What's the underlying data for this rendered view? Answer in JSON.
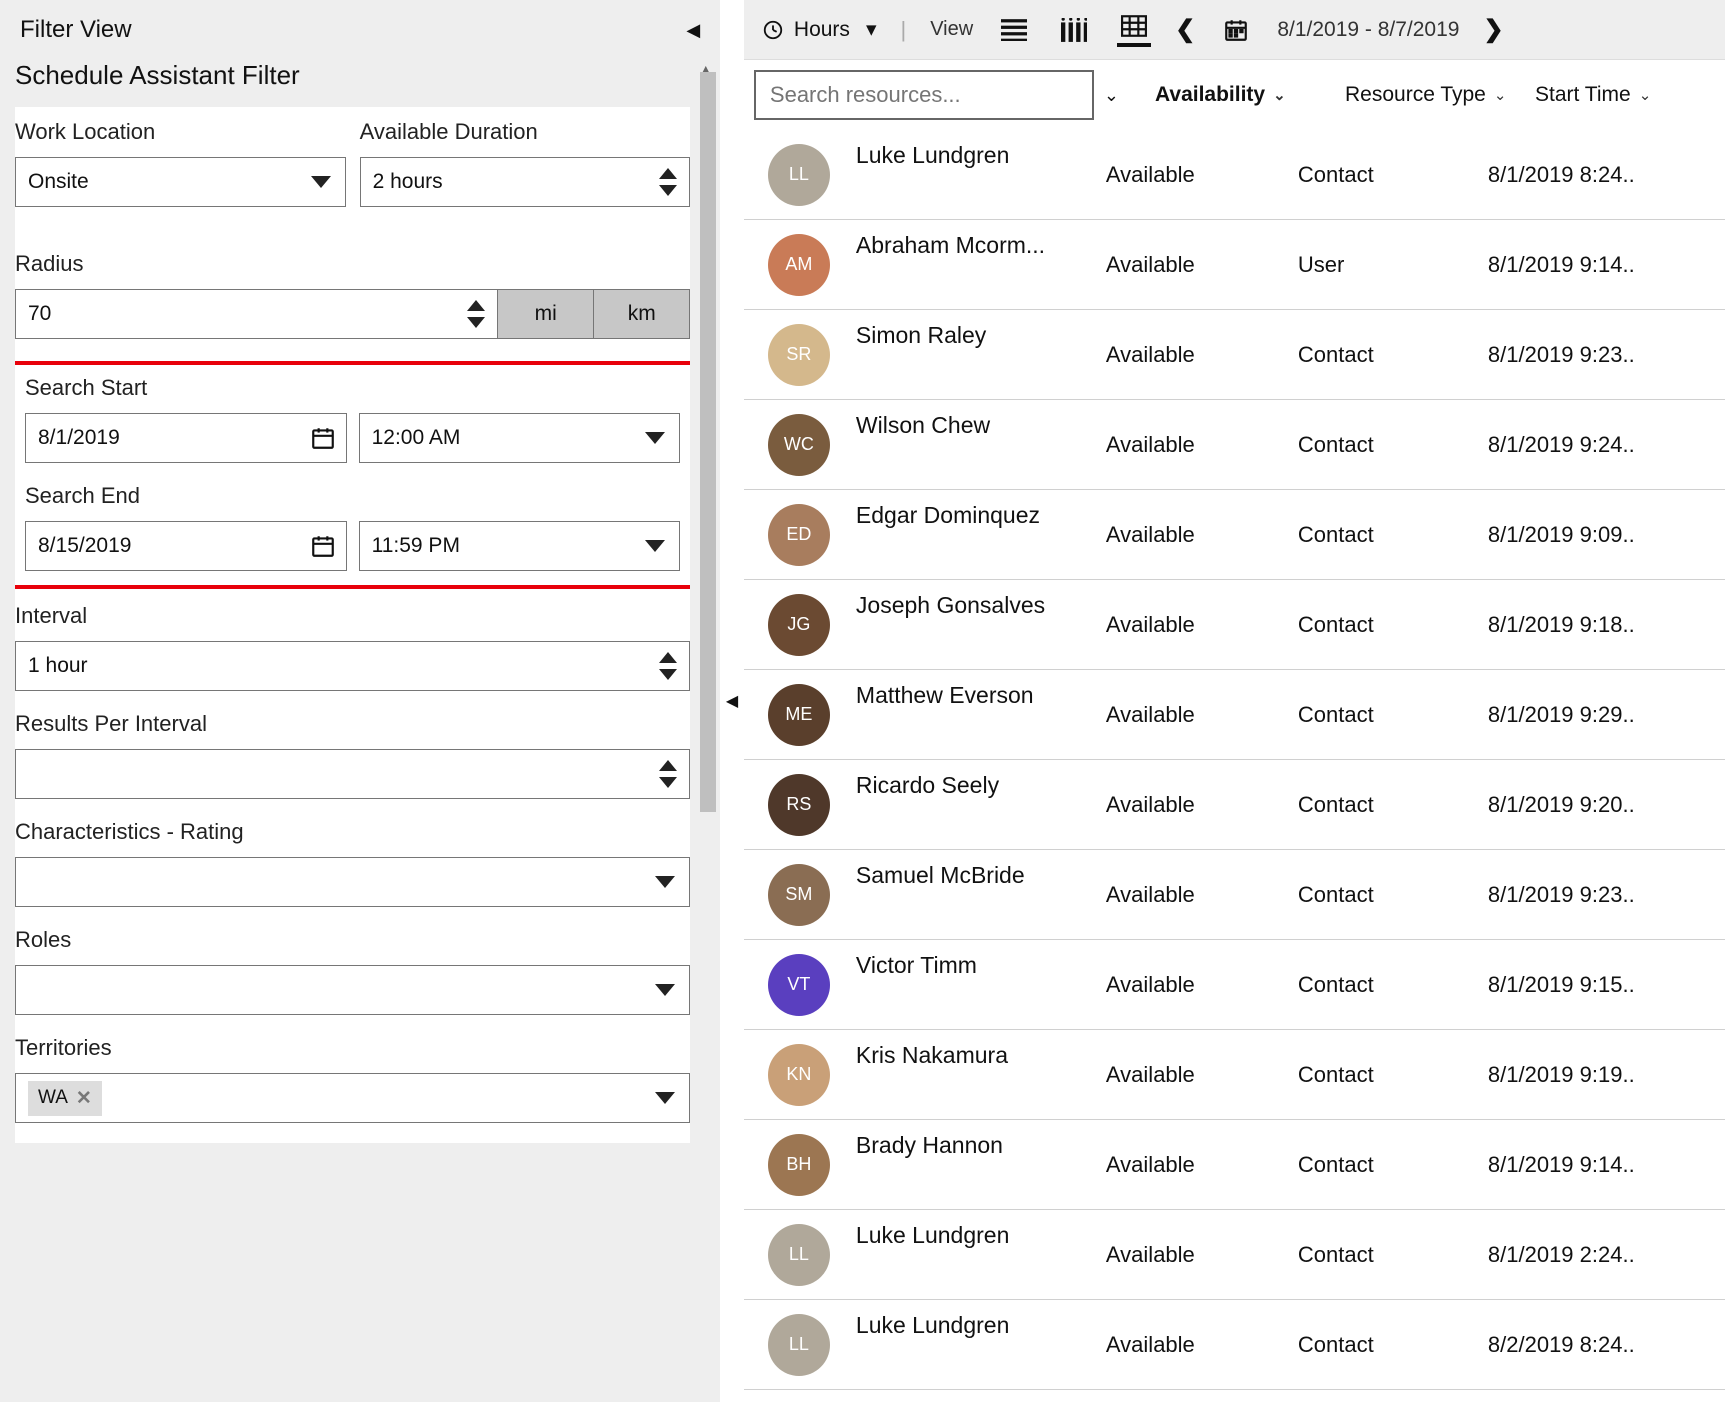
{
  "filter": {
    "panel_title": "Filter View",
    "subheader": "Schedule Assistant Filter",
    "work_location": {
      "label": "Work Location",
      "value": "Onsite"
    },
    "available_duration": {
      "label": "Available Duration",
      "value": "2 hours"
    },
    "radius": {
      "label": "Radius",
      "value": "70",
      "unit_mi": "mi",
      "unit_km": "km"
    },
    "search_start": {
      "label": "Search Start",
      "date": "8/1/2019",
      "time": "12:00 AM"
    },
    "search_end": {
      "label": "Search End",
      "date": "8/15/2019",
      "time": "11:59 PM"
    },
    "interval": {
      "label": "Interval",
      "value": "1 hour"
    },
    "results_per_interval": {
      "label": "Results Per Interval",
      "value": ""
    },
    "characteristics": {
      "label": "Characteristics - Rating",
      "value": ""
    },
    "roles": {
      "label": "Roles",
      "value": ""
    },
    "territories": {
      "label": "Territories",
      "chip": "WA"
    }
  },
  "toolbar": {
    "granularity": "Hours",
    "view_label": "View",
    "date_range": "8/1/2019 - 8/7/2019"
  },
  "grid": {
    "search_placeholder": "Search resources...",
    "columns": {
      "availability": "Availability",
      "type": "Resource Type",
      "start": "Start Time"
    },
    "rows": [
      {
        "name": "Luke Lundgren",
        "availability": "Available",
        "type": "Contact",
        "start": "8/1/2019 8:24..",
        "color": "#b0a89a"
      },
      {
        "name": "Abraham Mcorm...",
        "availability": "Available",
        "type": "User",
        "start": "8/1/2019 9:14..",
        "color": "#c97b57"
      },
      {
        "name": "Simon Raley",
        "availability": "Available",
        "type": "Contact",
        "start": "8/1/2019 9:23..",
        "color": "#d4b88c"
      },
      {
        "name": "Wilson Chew",
        "availability": "Available",
        "type": "Contact",
        "start": "8/1/2019 9:24..",
        "color": "#7a5c3e"
      },
      {
        "name": "Edgar Dominquez",
        "availability": "Available",
        "type": "Contact",
        "start": "8/1/2019 9:09..",
        "color": "#a87d5e"
      },
      {
        "name": "Joseph Gonsalves",
        "availability": "Available",
        "type": "Contact",
        "start": "8/1/2019 9:18..",
        "color": "#6b4a32"
      },
      {
        "name": "Matthew Everson",
        "availability": "Available",
        "type": "Contact",
        "start": "8/1/2019 9:29..",
        "color": "#5a3f2c"
      },
      {
        "name": "Ricardo Seely",
        "availability": "Available",
        "type": "Contact",
        "start": "8/1/2019 9:20..",
        "color": "#4f382a"
      },
      {
        "name": "Samuel McBride",
        "availability": "Available",
        "type": "Contact",
        "start": "8/1/2019 9:23..",
        "color": "#8a6d53"
      },
      {
        "name": "Victor Timm",
        "availability": "Available",
        "type": "Contact",
        "start": "8/1/2019 9:15..",
        "color": "#5a3fbf"
      },
      {
        "name": "Kris Nakamura",
        "availability": "Available",
        "type": "Contact",
        "start": "8/1/2019 9:19..",
        "color": "#c9a078"
      },
      {
        "name": "Brady Hannon",
        "availability": "Available",
        "type": "Contact",
        "start": "8/1/2019 9:14..",
        "color": "#9c7652"
      },
      {
        "name": "Luke Lundgren",
        "availability": "Available",
        "type": "Contact",
        "start": "8/1/2019 2:24..",
        "color": "#b0a89a"
      },
      {
        "name": "Luke Lundgren",
        "availability": "Available",
        "type": "Contact",
        "start": "8/2/2019 8:24..",
        "color": "#b0a89a"
      }
    ]
  }
}
